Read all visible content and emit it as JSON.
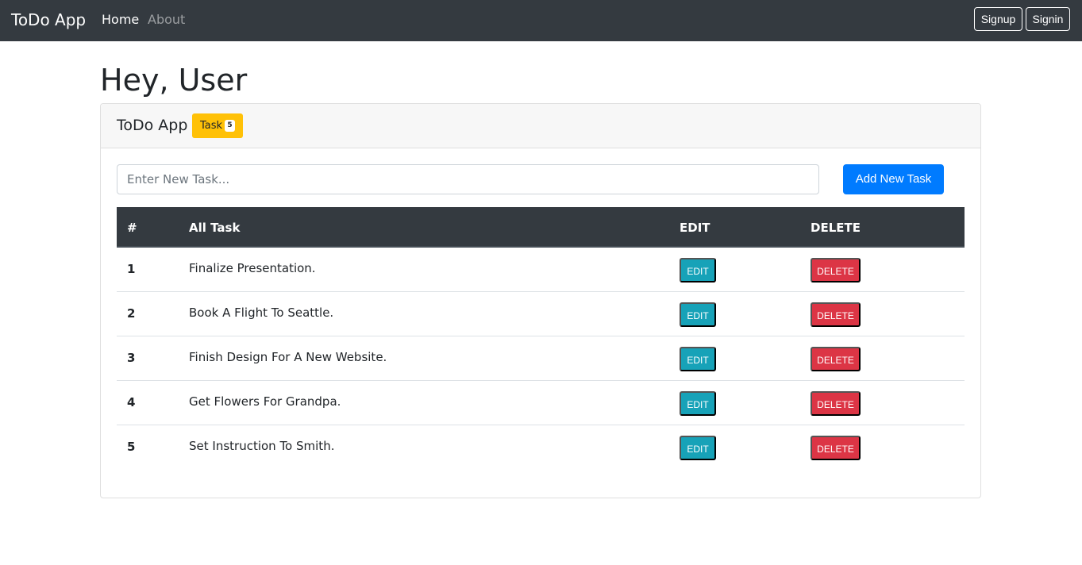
{
  "navbar": {
    "brand": "ToDo App",
    "links": [
      {
        "label": "Home",
        "active": true
      },
      {
        "label": "About",
        "active": false
      }
    ],
    "signup_label": "Signup",
    "signin_label": "Signin"
  },
  "heading": "Hey, User",
  "card": {
    "title": "ToDo App",
    "badge_label": "Task",
    "badge_count": "5",
    "input_placeholder": "Enter New Task...",
    "input_value": "",
    "add_label": "Add New Task"
  },
  "table": {
    "headers": [
      "#",
      "All Task",
      "EDIT",
      "DELETE"
    ],
    "rows": [
      {
        "num": "1",
        "task": "Finalize Presentation.",
        "edit": "EDIT",
        "delete": "DELETE"
      },
      {
        "num": "2",
        "task": "Book A Flight To Seattle.",
        "edit": "EDIT",
        "delete": "DELETE"
      },
      {
        "num": "3",
        "task": "Finish Design For A New Website.",
        "edit": "EDIT",
        "delete": "DELETE"
      },
      {
        "num": "4",
        "task": "Get Flowers For Grandpa.",
        "edit": "EDIT",
        "delete": "DELETE"
      },
      {
        "num": "5",
        "task": "Set Instruction To Smith.",
        "edit": "EDIT",
        "delete": "DELETE"
      }
    ]
  },
  "colors": {
    "navbar_bg": "#343a40",
    "primary": "#007bff",
    "warning": "#ffc107",
    "info": "#17a2b8",
    "danger": "#dc3545"
  }
}
